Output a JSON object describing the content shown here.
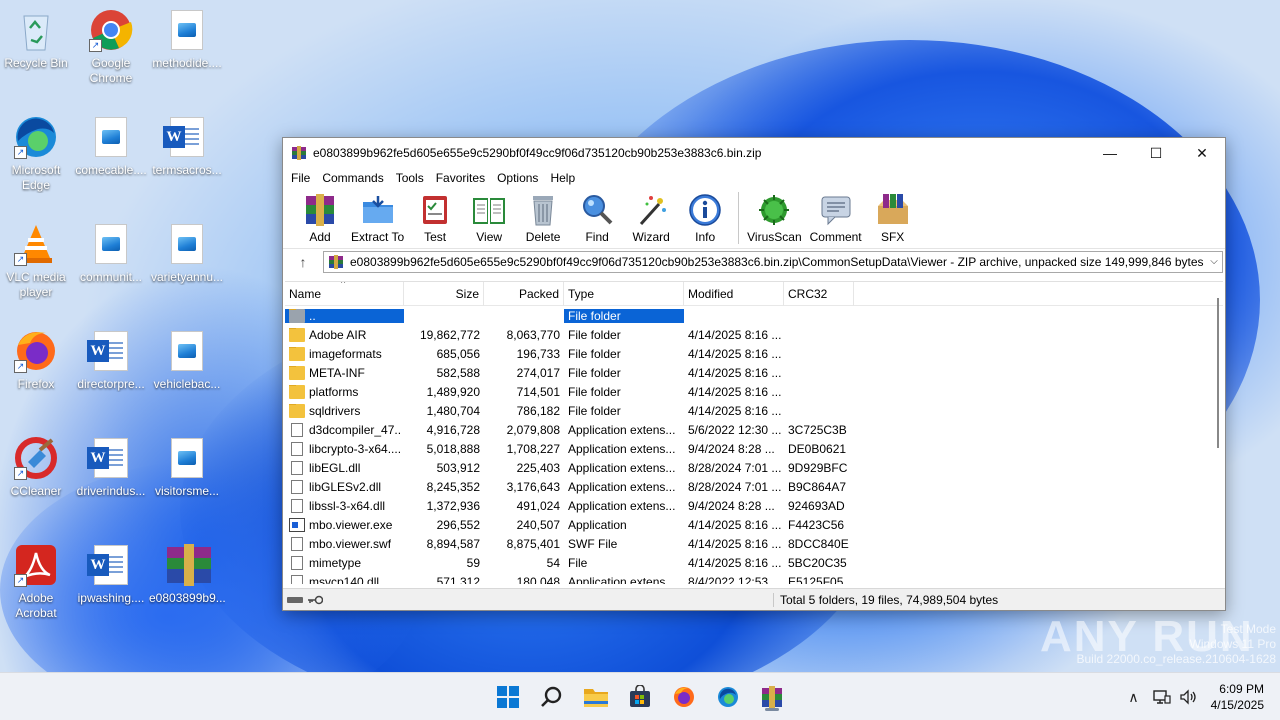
{
  "desktop": {
    "icons": [
      {
        "label": "Recycle Bin",
        "icon": "recycle-bin-icon"
      },
      {
        "label": "Google Chrome",
        "icon": "chrome-icon"
      },
      {
        "label": "methodide....",
        "icon": "image-file-icon"
      },
      {
        "label": "Microsoft Edge",
        "icon": "edge-icon"
      },
      {
        "label": "comecable....",
        "icon": "image-file-icon"
      },
      {
        "label": "termsacros...",
        "icon": "word-doc-icon"
      },
      {
        "label": "VLC media player",
        "icon": "vlc-icon"
      },
      {
        "label": "communit...",
        "icon": "image-file-icon"
      },
      {
        "label": "varietyannu...",
        "icon": "image-file-icon"
      },
      {
        "label": "Firefox",
        "icon": "firefox-icon"
      },
      {
        "label": "directorpre...",
        "icon": "word-doc-icon"
      },
      {
        "label": "vehiclebac...",
        "icon": "image-file-icon"
      },
      {
        "label": "CCleaner",
        "icon": "ccleaner-icon"
      },
      {
        "label": "driverindus...",
        "icon": "word-doc-icon"
      },
      {
        "label": "visitorsme...",
        "icon": "image-file-icon"
      },
      {
        "label": "Adobe Acrobat",
        "icon": "acrobat-icon"
      },
      {
        "label": "ipwashing....",
        "icon": "word-doc-icon"
      },
      {
        "label": "e0803899b9...",
        "icon": "winrar-icon"
      }
    ]
  },
  "window": {
    "title": "e0803899b962fe5d605e655e9c5290bf0f49cc9f06d735120cb90b253e3883c6.bin.zip",
    "minimize": "—",
    "maximize": "☐",
    "close": "✕"
  },
  "menu": [
    "File",
    "Commands",
    "Tools",
    "Favorites",
    "Options",
    "Help"
  ],
  "toolbar": [
    {
      "label": "Add",
      "icon": "add-archive-icon"
    },
    {
      "label": "Extract To",
      "icon": "extract-folder-icon"
    },
    {
      "label": "Test",
      "icon": "test-checklist-icon"
    },
    {
      "label": "View",
      "icon": "view-book-icon"
    },
    {
      "label": "Delete",
      "icon": "trash-icon"
    },
    {
      "label": "Find",
      "icon": "magnifier-icon"
    },
    {
      "label": "Wizard",
      "icon": "wand-icon"
    },
    {
      "label": "Info",
      "icon": "info-icon"
    },
    {
      "label": "VirusScan",
      "icon": "virus-scan-icon"
    },
    {
      "label": "Comment",
      "icon": "comment-icon"
    },
    {
      "label": "SFX",
      "icon": "sfx-box-icon"
    }
  ],
  "address": {
    "up": "↑",
    "path": "e0803899b962fe5d605e655e9c5290bf0f49cc9f06d735120cb90b253e3883c6.bin.zip\\CommonSetupData\\Viewer - ZIP archive, unpacked size 149,999,846 bytes",
    "dropdown": "⌵"
  },
  "columns": {
    "name": "Name",
    "size": "Size",
    "packed": "Packed",
    "type": "Type",
    "modified": "Modified",
    "crc": "CRC32"
  },
  "files": [
    {
      "name": "..",
      "size": "",
      "packed": "",
      "type": "File folder",
      "modified": "",
      "crc": "",
      "kind": "up",
      "selected": true
    },
    {
      "name": "Adobe AIR",
      "size": "19,862,772",
      "packed": "8,063,770",
      "type": "File folder",
      "modified": "4/14/2025 8:16 ...",
      "crc": "",
      "kind": "folder"
    },
    {
      "name": "imageformats",
      "size": "685,056",
      "packed": "196,733",
      "type": "File folder",
      "modified": "4/14/2025 8:16 ...",
      "crc": "",
      "kind": "folder"
    },
    {
      "name": "META-INF",
      "size": "582,588",
      "packed": "274,017",
      "type": "File folder",
      "modified": "4/14/2025 8:16 ...",
      "crc": "",
      "kind": "folder"
    },
    {
      "name": "platforms",
      "size": "1,489,920",
      "packed": "714,501",
      "type": "File folder",
      "modified": "4/14/2025 8:16 ...",
      "crc": "",
      "kind": "folder"
    },
    {
      "name": "sqldrivers",
      "size": "1,480,704",
      "packed": "786,182",
      "type": "File folder",
      "modified": "4/14/2025 8:16 ...",
      "crc": "",
      "kind": "folder"
    },
    {
      "name": "d3dcompiler_47....",
      "size": "4,916,728",
      "packed": "2,079,808",
      "type": "Application extens...",
      "modified": "5/6/2022 12:30 ...",
      "crc": "3C725C3B",
      "kind": "file"
    },
    {
      "name": "libcrypto-3-x64....",
      "size": "5,018,888",
      "packed": "1,708,227",
      "type": "Application extens...",
      "modified": "9/4/2024 8:28 ...",
      "crc": "DE0B0621",
      "kind": "file"
    },
    {
      "name": "libEGL.dll",
      "size": "503,912",
      "packed": "225,403",
      "type": "Application extens...",
      "modified": "8/28/2024 7:01 ...",
      "crc": "9D929BFC",
      "kind": "file"
    },
    {
      "name": "libGLESv2.dll",
      "size": "8,245,352",
      "packed": "3,176,643",
      "type": "Application extens...",
      "modified": "8/28/2024 7:01 ...",
      "crc": "B9C864A7",
      "kind": "file"
    },
    {
      "name": "libssl-3-x64.dll",
      "size": "1,372,936",
      "packed": "491,024",
      "type": "Application extens...",
      "modified": "9/4/2024 8:28 ...",
      "crc": "924693AD",
      "kind": "file"
    },
    {
      "name": "mbo.viewer.exe",
      "size": "296,552",
      "packed": "240,507",
      "type": "Application",
      "modified": "4/14/2025 8:16 ...",
      "crc": "F4423C56",
      "kind": "exe"
    },
    {
      "name": "mbo.viewer.swf",
      "size": "8,894,587",
      "packed": "8,875,401",
      "type": "SWF File",
      "modified": "4/14/2025 8:16 ...",
      "crc": "8DCC840E",
      "kind": "file"
    },
    {
      "name": "mimetype",
      "size": "59",
      "packed": "54",
      "type": "File",
      "modified": "4/14/2025 8:16 ...",
      "crc": "5BC20C35",
      "kind": "file"
    },
    {
      "name": "msvcp140.dll",
      "size": "571,312",
      "packed": "180,048",
      "type": "Application extens...",
      "modified": "8/4/2022 12:53 ...",
      "crc": "E5125F05",
      "kind": "file"
    }
  ],
  "status": {
    "summary": "Total 5 folders, 19 files, 74,989,504 bytes"
  },
  "taskbar": {
    "apps": [
      "start-icon",
      "search-icon",
      "file-explorer-icon",
      "store-icon",
      "firefox-icon",
      "edge-icon",
      "winrar-icon"
    ],
    "time": "6:09 PM",
    "date": "4/15/2025",
    "tray_chevron": "∧"
  },
  "watermark": {
    "line1": "Test Mode",
    "line2": "Windows 11 Pro",
    "line3": "Build 22000.co_release.210604-1628",
    "brand": "ANY RUN"
  }
}
